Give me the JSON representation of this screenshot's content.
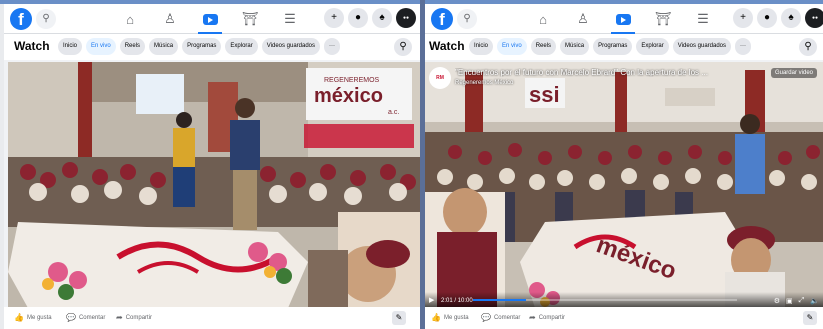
{
  "left": {
    "fb_logo": "f",
    "watch_title": "Watch",
    "chips": [
      {
        "label": "Inicio",
        "active": false
      },
      {
        "label": "En vivo",
        "active": true
      },
      {
        "label": "Reels",
        "active": false
      },
      {
        "label": "Música",
        "active": false
      },
      {
        "label": "Programas",
        "active": false
      },
      {
        "label": "Explorar",
        "active": false
      },
      {
        "label": "Videos guardados",
        "active": false
      },
      {
        "label": "···",
        "active": false
      }
    ],
    "footer": {
      "like": "Me gusta",
      "comment": "Comentar",
      "share": "Compartir"
    },
    "video_banner": {
      "line1": "REGENEREMOS",
      "line2": "méxico",
      "line3": "a.c."
    }
  },
  "right": {
    "fb_logo": "f",
    "watch_title": "Watch",
    "chips": [
      {
        "label": "Inicio",
        "active": false
      },
      {
        "label": "En vivo",
        "active": true
      },
      {
        "label": "Reels",
        "active": false
      },
      {
        "label": "Música",
        "active": false
      },
      {
        "label": "Programas",
        "active": false
      },
      {
        "label": "Explorar",
        "active": false
      },
      {
        "label": "Videos guardados",
        "active": false
      },
      {
        "label": "···",
        "active": false
      }
    ],
    "overlay": {
      "title": "\"Encuentros por el futuro con Marcelo Ebrard\" Con la apertura de los ...",
      "subtitle": "Regeneremos México",
      "save": "Guardar video",
      "time": "2:01 / 10:00",
      "progress": 0.2
    },
    "footer": {
      "like": "Me gusta",
      "comment": "Comentar",
      "share": "Compartir"
    },
    "floor_banner": "méxico"
  },
  "colors": {
    "fb_blue": "#1877f2",
    "brand_red": "#c8102e"
  }
}
